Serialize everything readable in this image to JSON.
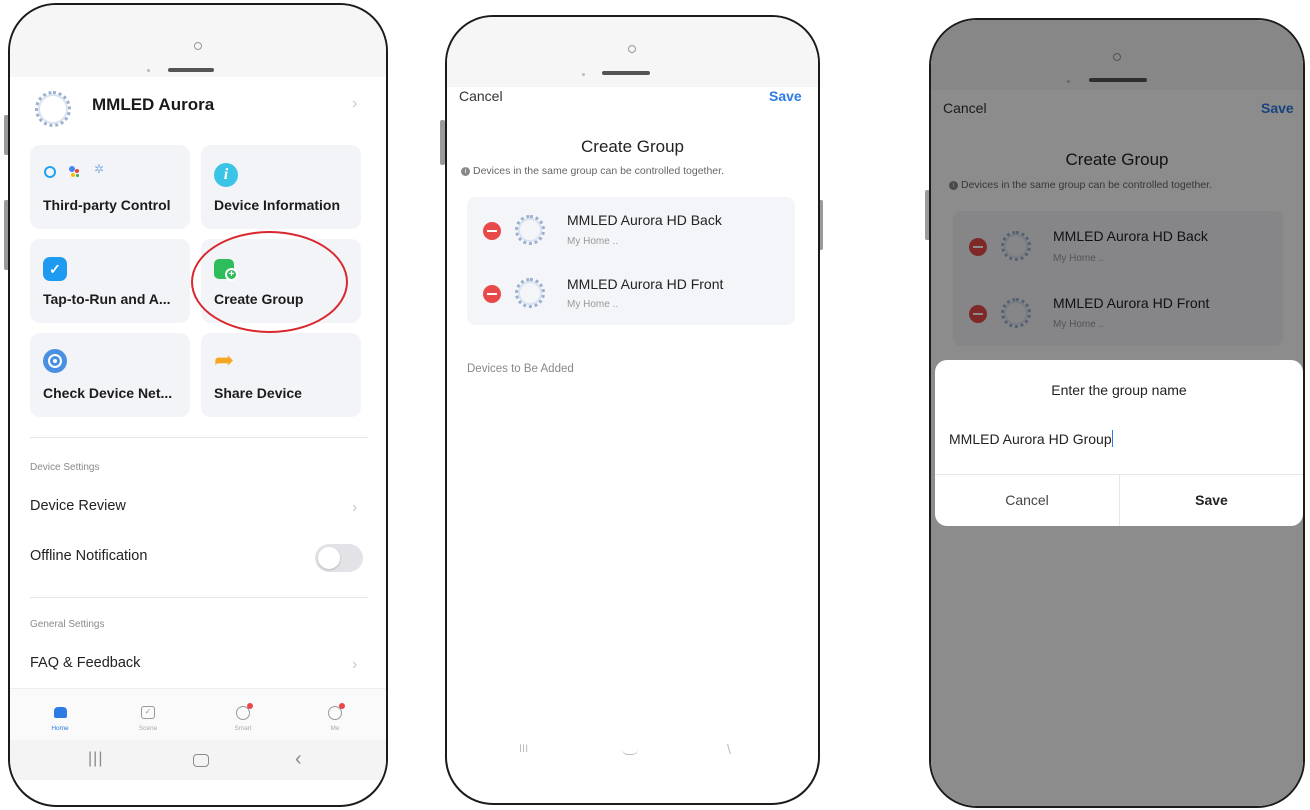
{
  "screen1": {
    "device_title": "MMLED Aurora",
    "cards": [
      {
        "label": "Third-party Control",
        "icon": "voice-assistants-icon"
      },
      {
        "label": "Device Information",
        "icon": "info-icon"
      },
      {
        "label": "Tap-to-Run and A...",
        "icon": "checkmark-hex-icon"
      },
      {
        "label": "Create Group",
        "icon": "create-group-icon"
      },
      {
        "label": "Check Device Net...",
        "icon": "network-icon"
      },
      {
        "label": "Share Device",
        "icon": "share-arrow-icon"
      }
    ],
    "device_settings_header": "Device Settings",
    "device_review": "Device Review",
    "offline_notification": "Offline Notification",
    "general_settings_header": "General Settings",
    "faq": "FAQ & Feedback",
    "nav": [
      {
        "label": "Home",
        "icon": "home-icon"
      },
      {
        "label": "Scene",
        "icon": "scene-icon"
      },
      {
        "label": "Smart",
        "icon": "smart-icon"
      },
      {
        "label": "Me",
        "icon": "me-icon"
      }
    ],
    "colors": {
      "accent": "#2d7be5",
      "highlight": "#d9272e"
    }
  },
  "screen2": {
    "cancel": "Cancel",
    "save": "Save",
    "title": "Create Group",
    "hint": "Devices in the same group can be controlled together.",
    "devices": [
      {
        "name": "MMLED Aurora HD Back",
        "sub": "My Home .."
      },
      {
        "name": "MMLED Aurora HD Front",
        "sub": "My Home .."
      }
    ],
    "to_be_added": "Devices to Be Added"
  },
  "screen3": {
    "cancel": "Cancel",
    "save": "Save",
    "title": "Create Group",
    "hint": "Devices in the same group can be controlled together.",
    "devices": [
      {
        "name": "MMLED Aurora HD Back",
        "sub": "My Home .."
      },
      {
        "name": "MMLED Aurora HD Front",
        "sub": "My Home .."
      }
    ],
    "dialog": {
      "title": "Enter the group name",
      "value": "MMLED Aurora HD Group",
      "cancel": "Cancel",
      "save": "Save"
    }
  }
}
